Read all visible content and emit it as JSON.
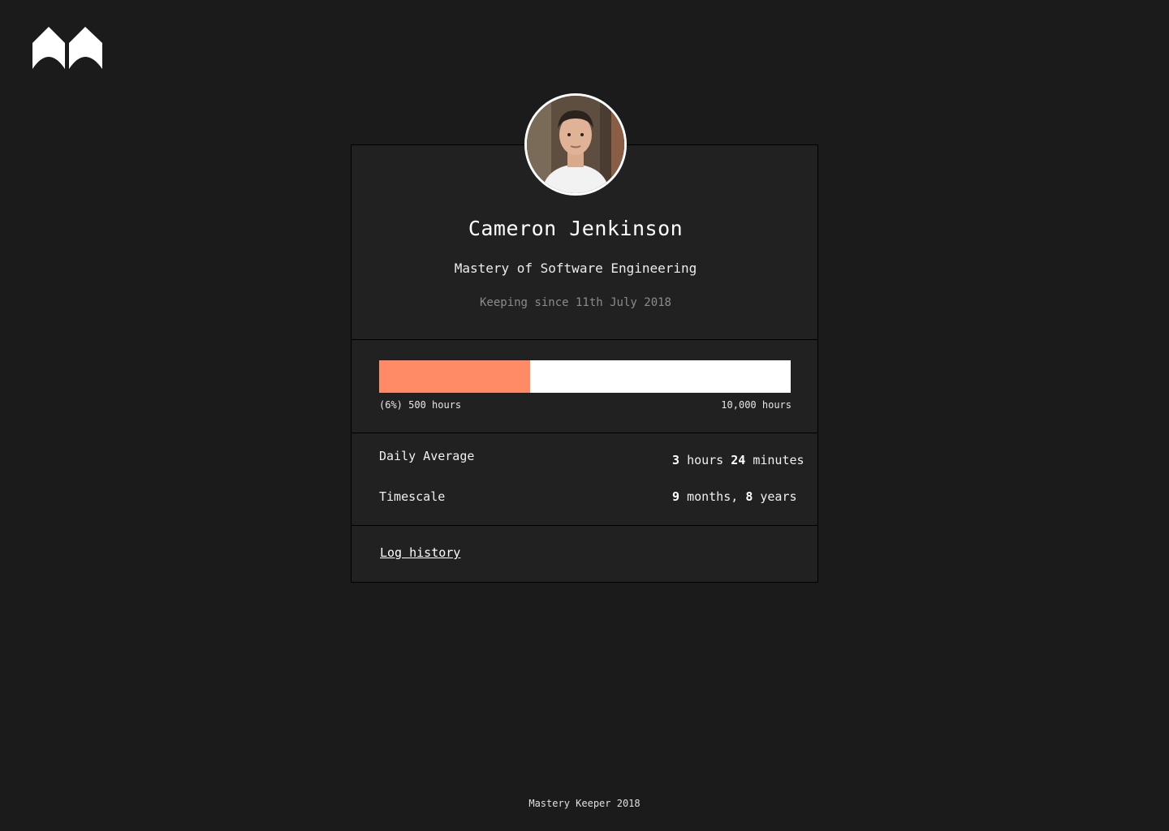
{
  "app": {
    "logo_icon": "mastery-keeper-logo-icon"
  },
  "profile": {
    "avatar_icon": "user-avatar",
    "name": "Cameron Jenkinson",
    "goal": "Mastery of Software Engineering",
    "since": "Keeping since 11th July 2018"
  },
  "progress": {
    "fraction": 0.367,
    "left_label": "(6%) 500 hours",
    "right_label": "10,000 hours",
    "fill_color": "#ff8a65",
    "track_color": "#ffffff"
  },
  "stats": {
    "daily_average": {
      "label": "Daily Average",
      "hours": "3",
      "hours_unit": "hours",
      "minutes": "24",
      "minutes_unit": "minutes"
    },
    "timescale": {
      "label": "Timescale",
      "months": "9",
      "months_unit": "months,",
      "years": "8",
      "years_unit": "years"
    }
  },
  "actions": {
    "log_history": "Log history"
  },
  "footer": {
    "text": "Mastery Keeper 2018"
  }
}
